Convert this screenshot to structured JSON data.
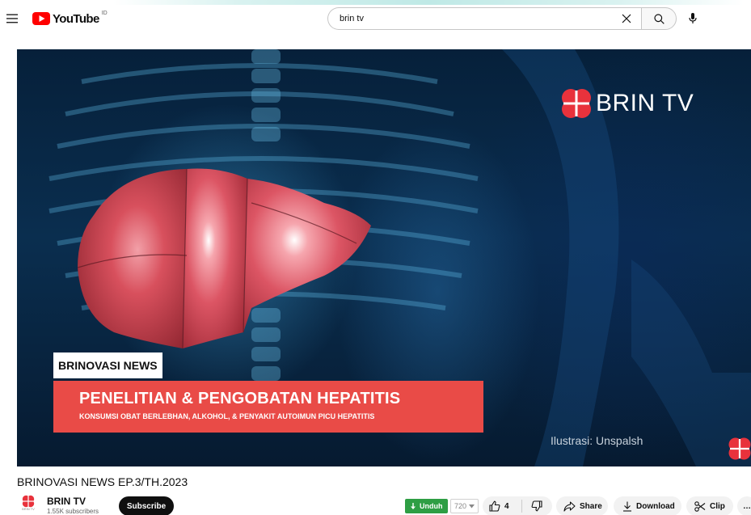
{
  "header": {
    "logo_text": "YouTube",
    "logo_country": "ID",
    "search_value": "brin tv",
    "icons": [
      "menu-icon",
      "youtube-logo-icon",
      "close-icon",
      "search-icon",
      "mic-icon"
    ]
  },
  "video": {
    "watermark_text": "BRIN TV",
    "news_tag": "BRINOVASI NEWS",
    "news_headline": "PENELITIAN & PENGOBATAN HEPATITIS",
    "news_subheadline": "KONSUMSI OBAT BERLEBHAN, ALKOHOL, & PENYAKIT AUTOIMUN PICU HEPATITIS",
    "image_credit": "Ilustrasi: Unspalsh",
    "colors": {
      "news_band": "#e94b47",
      "brin_red": "#e8323c"
    }
  },
  "info": {
    "title": "BRINOVASI NEWS EP.3/TH.2023",
    "avatar_label": "BRIN TV",
    "channel_name": "BRIN TV",
    "subscribers": "1.55K subscribers",
    "subscribe_label": "Subscribe"
  },
  "actions": {
    "unduh_label": "Unduh",
    "quality": "720",
    "like_count": "4",
    "share_label": "Share",
    "download_label": "Download",
    "clip_label": "Clip",
    "more_label": "…",
    "icons": [
      "download-arrow-icon",
      "thumbs-up-icon",
      "thumbs-down-icon",
      "share-arrow-icon",
      "download-icon",
      "scissors-icon",
      "more-icon"
    ]
  }
}
